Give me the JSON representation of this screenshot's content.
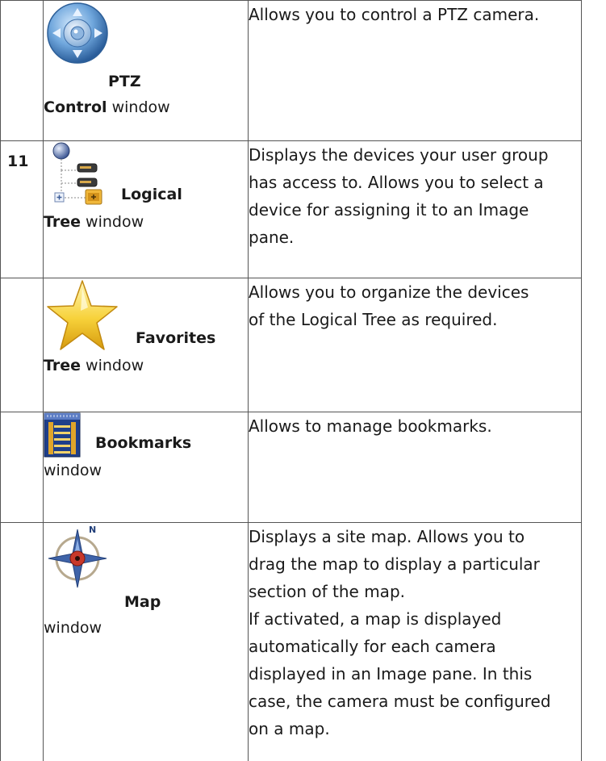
{
  "rows": [
    {
      "number": "",
      "icon": "ptz-control-icon",
      "name_bold_1": "PTZ",
      "name_bold_2": "Control",
      "name_rest": " window",
      "description_lines": [
        "Allows you to control a PTZ camera."
      ]
    },
    {
      "number": "11",
      "icon": "logical-tree-icon",
      "name_bold_1": "Logical",
      "name_bold_2": "Tree",
      "name_rest": " window",
      "description_lines": [
        "Displays the devices your user group",
        "has access to. Allows you to select a",
        "device for assigning it to an Image",
        "pane."
      ]
    },
    {
      "number": "",
      "icon": "star-icon",
      "name_bold_1": "Favorites",
      "name_bold_2": "Tree",
      "name_rest": " window",
      "description_lines": [
        "Allows you to organize the devices",
        "of the Logical Tree as required."
      ]
    },
    {
      "number": "",
      "icon": "bookmarks-icon",
      "name_bold_1": "Bookmarks",
      "name_bold_2": "",
      "name_rest": "window",
      "description_lines": [
        "Allows to manage bookmarks."
      ]
    },
    {
      "number": "",
      "icon": "compass-icon",
      "name_bold_1": "Map",
      "name_bold_2": "",
      "name_rest": "window",
      "description_lines": [
        "Displays a site map. Allows you to",
        "drag the map to display a particular",
        "section of the map.",
        "If activated, a map is displayed",
        "automatically for each camera",
        "displayed in an Image pane. In this",
        "case, the camera must be configured",
        "on a map."
      ]
    }
  ]
}
